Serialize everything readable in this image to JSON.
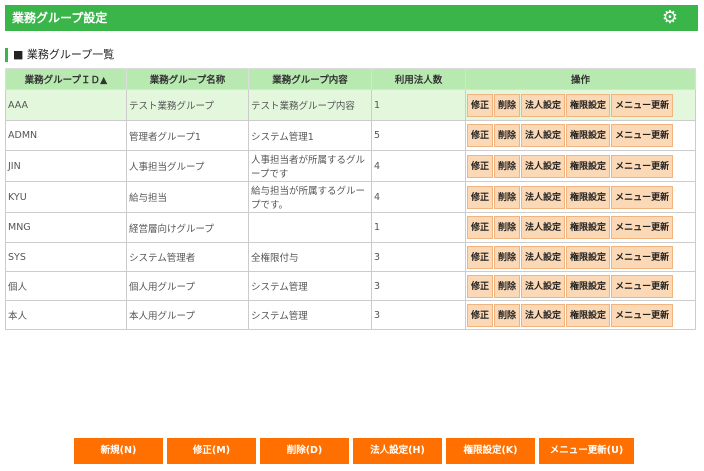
{
  "header": {
    "title": "業務グループ設定",
    "icon": "gear-icon"
  },
  "section": {
    "title": "■ 業務グループ一覧"
  },
  "table": {
    "columns": [
      "業務グループＩＤ▲",
      "業務グループ名称",
      "業務グループ内容",
      "利用法人数",
      "操作"
    ],
    "row_actions": [
      "修正",
      "削除",
      "法人設定",
      "権限設定",
      "メニュー更新"
    ],
    "rows": [
      {
        "id": "AAA",
        "name": "テスト業務グループ",
        "desc": "テスト業務グループ内容",
        "count": "1"
      },
      {
        "id": "ADMN",
        "name": "管理者グループ1",
        "desc": "システム管理1",
        "count": "5"
      },
      {
        "id": "JIN",
        "name": "人事担当グループ",
        "desc": "人事担当者が所属するグループです",
        "count": "4"
      },
      {
        "id": "KYU",
        "name": "給与担当",
        "desc": "給与担当が所属するグループです。",
        "count": "4"
      },
      {
        "id": "MNG",
        "name": "経営層向けグループ",
        "desc": "",
        "count": "1"
      },
      {
        "id": "SYS",
        "name": "システム管理者",
        "desc": "全権限付与",
        "count": "3"
      },
      {
        "id": "個人",
        "name": "個人用グループ",
        "desc": "システム管理",
        "count": "3"
      },
      {
        "id": "本人",
        "name": "本人用グループ",
        "desc": "システム管理",
        "count": "3"
      }
    ]
  },
  "footer": {
    "buttons": [
      "新規(N)",
      "修正(M)",
      "削除(D)",
      "法人設定(H)",
      "権限設定(K)",
      "メニュー更新(U)"
    ]
  },
  "colors": {
    "header": "#39b54a",
    "table_header": "#b7e9b0",
    "selected_row": "#e2f7dc",
    "action_button": "#fcd9b6",
    "footer_button": "#ff7000"
  }
}
